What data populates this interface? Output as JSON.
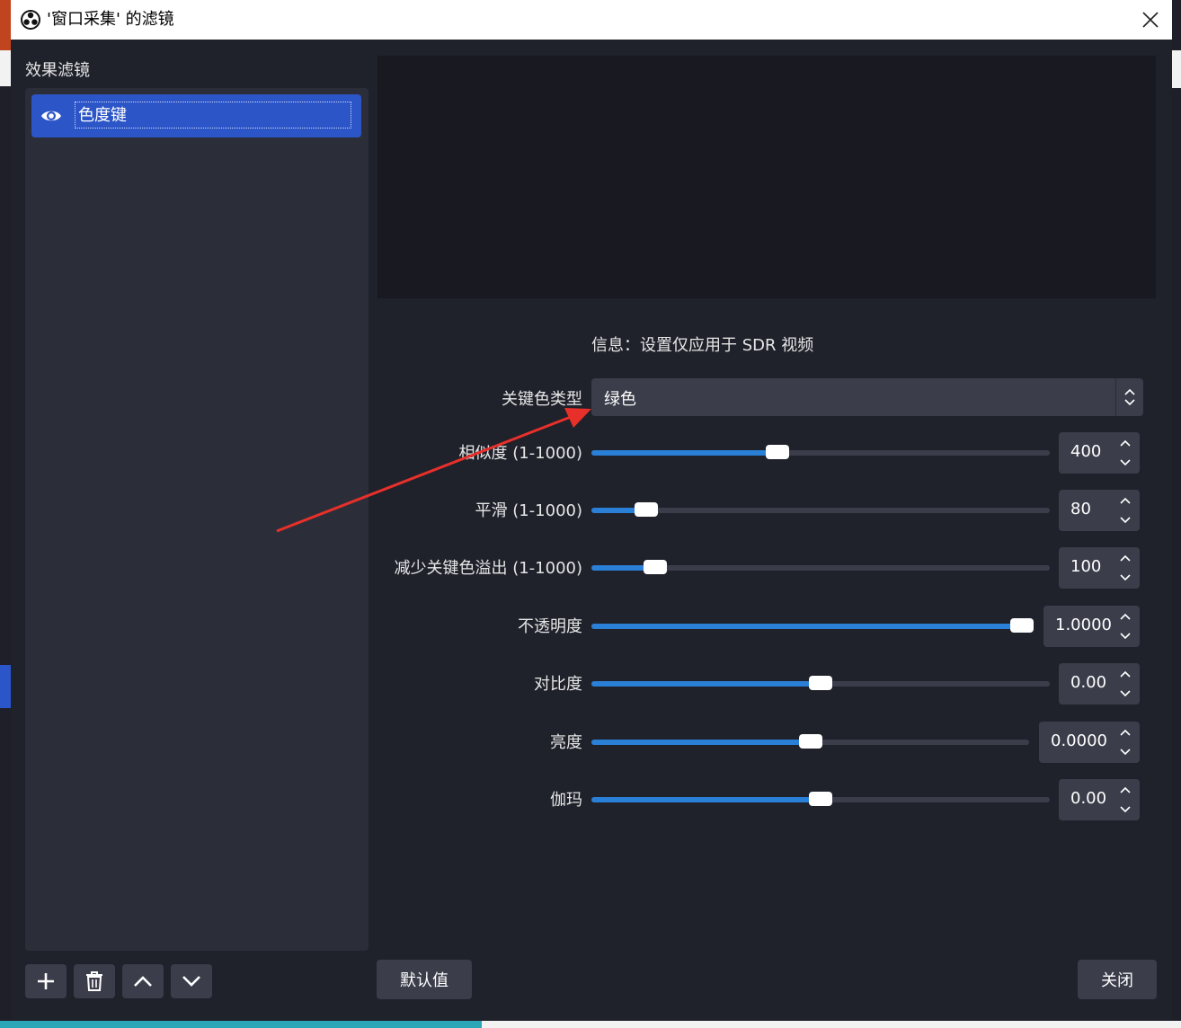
{
  "window": {
    "title": "'窗口采集' 的滤镜"
  },
  "filters": {
    "label": "效果滤镜",
    "items": [
      {
        "label": "色度键",
        "visible": true
      }
    ]
  },
  "info": "信息：设置仅应用于 SDR 视频",
  "key_color": {
    "label": "关键色类型",
    "value": "绿色"
  },
  "sliders": [
    {
      "label": "相似度 (1-1000)",
      "value": "400",
      "fraction": 0.4
    },
    {
      "label": "平滑 (1-1000)",
      "value": "80",
      "fraction": 0.1
    },
    {
      "label": "减少关键色溢出 (1-1000)",
      "value": "100",
      "fraction": 0.12
    },
    {
      "label": "不透明度",
      "value": "1.0000",
      "fraction": 1.0
    },
    {
      "label": "对比度",
      "value": "0.00",
      "fraction": 0.5
    },
    {
      "label": "亮度",
      "value": "0.0000",
      "fraction": 0.5
    },
    {
      "label": "伽玛",
      "value": "0.00",
      "fraction": 0.5
    }
  ],
  "buttons": {
    "defaults": "默认值",
    "close": "关闭"
  },
  "colors": {
    "accent": "#2c55c7",
    "slider_fill": "#2a7fd6",
    "annotation_arrow": "#e8302a"
  }
}
